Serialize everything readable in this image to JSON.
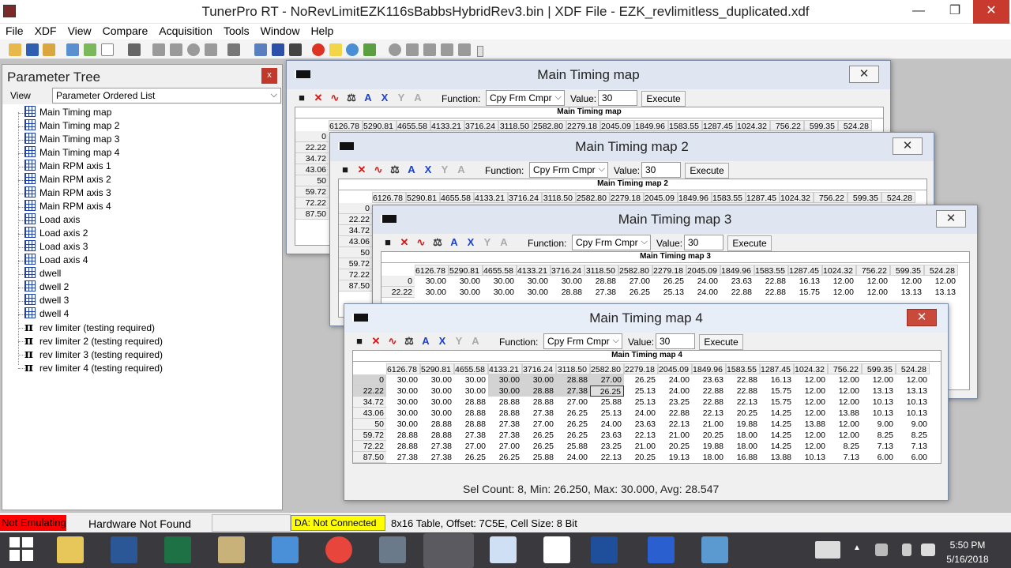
{
  "app": {
    "title": "TunerPro RT - NoRevLimitEZK116sBabbsHybridRev3.bin | XDF File - EZK_revlimitless_duplicated.xdf",
    "minimize": "—",
    "maximize": "❐",
    "close": "✕"
  },
  "menu": [
    "File",
    "XDF",
    "View",
    "Compare",
    "Acquisition",
    "Tools",
    "Window",
    "Help"
  ],
  "tree": {
    "title": "Parameter Tree",
    "close": "x",
    "view_label": "View",
    "view_value": "Parameter Ordered List",
    "items": [
      {
        "label": "Main Timing map",
        "icon": "table-icon"
      },
      {
        "label": "Main Timing map 2",
        "icon": "table-icon"
      },
      {
        "label": "Main Timing map 3",
        "icon": "table-icon"
      },
      {
        "label": "Main Timing map 4",
        "icon": "table-icon"
      },
      {
        "label": "Main RPM axis 1",
        "icon": "table-icon"
      },
      {
        "label": "Main RPM axis 2",
        "icon": "table-icon"
      },
      {
        "label": "Main RPM axis 3",
        "icon": "table-icon"
      },
      {
        "label": "Main RPM axis 4",
        "icon": "table-icon"
      },
      {
        "label": "Load axis",
        "icon": "table-icon"
      },
      {
        "label": "Load axis 2",
        "icon": "table-icon"
      },
      {
        "label": "Load axis 3",
        "icon": "table-icon"
      },
      {
        "label": "Load axis 4",
        "icon": "table-icon"
      },
      {
        "label": "dwell",
        "icon": "table-icon"
      },
      {
        "label": "dwell 2",
        "icon": "table-icon"
      },
      {
        "label": "dwell 3",
        "icon": "table-icon"
      },
      {
        "label": "dwell 4",
        "icon": "table-icon"
      },
      {
        "label": "rev limiter (testing required)",
        "icon": "pi-icon"
      },
      {
        "label": "rev limiter 2 (testing required)",
        "icon": "pi-icon"
      },
      {
        "label": "rev limiter 3 (testing required)",
        "icon": "pi-icon"
      },
      {
        "label": "rev limiter 4 (testing required)",
        "icon": "pi-icon"
      }
    ]
  },
  "editor": {
    "function_label": "Function:",
    "function_value": "Cpy Frm Cmpr",
    "value_label": "Value:",
    "value_value": "30",
    "execute": "Execute"
  },
  "columns": [
    "6126.78",
    "5290.81",
    "4655.58",
    "4133.21",
    "3716.24",
    "3118.50",
    "2582.80",
    "2279.18",
    "2045.09",
    "1849.96",
    "1583.55",
    "1287.45",
    "1024.32",
    "756.22",
    "599.35",
    "524.28"
  ],
  "rows": [
    "0",
    "22.22",
    "34.72",
    "43.06",
    "50",
    "59.72",
    "72.22",
    "87.50"
  ],
  "windows": {
    "w1": {
      "title": "Main Timing map",
      "grid_title": "Main Timing map"
    },
    "w2": {
      "title": "Main Timing map 2",
      "grid_title": "Main Timing map 2"
    },
    "w3": {
      "title": "Main Timing map 3",
      "grid_title": "Main Timing map 3"
    },
    "w4": {
      "title": "Main Timing map 4",
      "grid_title": "Main Timing map 4"
    }
  },
  "map3_values": [
    [
      "30.00",
      "30.00",
      "30.00",
      "30.00",
      "30.00",
      "28.88",
      "27.00",
      "26.25",
      "24.00",
      "23.63",
      "22.88",
      "16.13",
      "12.00",
      "12.00",
      "12.00",
      "12.00"
    ],
    [
      "30.00",
      "30.00",
      "30.00",
      "30.00",
      "28.88",
      "27.38",
      "26.25",
      "25.13",
      "24.00",
      "22.88",
      "22.88",
      "15.75",
      "12.00",
      "12.00",
      "13.13",
      "13.13"
    ]
  ],
  "map4_values": [
    [
      "30.00",
      "30.00",
      "30.00",
      "30.00",
      "30.00",
      "28.88",
      "27.00",
      "26.25",
      "24.00",
      "23.63",
      "22.88",
      "16.13",
      "12.00",
      "12.00",
      "12.00",
      "12.00"
    ],
    [
      "30.00",
      "30.00",
      "30.00",
      "30.00",
      "28.88",
      "27.38",
      "26.25",
      "25.13",
      "24.00",
      "22.88",
      "22.88",
      "15.75",
      "12.00",
      "12.00",
      "13.13",
      "13.13"
    ],
    [
      "30.00",
      "30.00",
      "28.88",
      "28.88",
      "28.88",
      "27.00",
      "25.88",
      "25.13",
      "23.25",
      "22.88",
      "22.13",
      "15.75",
      "12.00",
      "12.00",
      "10.13",
      "10.13"
    ],
    [
      "30.00",
      "30.00",
      "28.88",
      "28.88",
      "27.38",
      "26.25",
      "25.13",
      "24.00",
      "22.88",
      "22.13",
      "20.25",
      "14.25",
      "12.00",
      "13.88",
      "10.13",
      "10.13"
    ],
    [
      "30.00",
      "28.88",
      "28.88",
      "27.38",
      "27.00",
      "26.25",
      "24.00",
      "23.63",
      "22.13",
      "21.00",
      "19.88",
      "14.25",
      "13.88",
      "12.00",
      "9.00",
      "9.00"
    ],
    [
      "28.88",
      "28.88",
      "27.38",
      "27.38",
      "26.25",
      "26.25",
      "23.63",
      "22.13",
      "21.00",
      "20.25",
      "18.00",
      "14.25",
      "12.00",
      "12.00",
      "8.25",
      "8.25"
    ],
    [
      "28.88",
      "27.38",
      "27.00",
      "27.00",
      "26.25",
      "25.88",
      "23.25",
      "21.00",
      "20.25",
      "19.88",
      "18.00",
      "14.25",
      "12.00",
      "8.25",
      "7.13",
      "7.13"
    ],
    [
      "27.38",
      "27.38",
      "26.25",
      "26.25",
      "25.88",
      "24.00",
      "22.13",
      "20.25",
      "19.13",
      "18.00",
      "16.88",
      "13.88",
      "10.13",
      "7.13",
      "6.00",
      "6.00"
    ]
  ],
  "partial_values_right": [
    "00",
    "13",
    "00",
    "13",
    "00",
    "00"
  ],
  "selection_status": "Sel Count: 8, Min: 26.250, Max: 30.000, Avg: 28.547",
  "status": {
    "emulating": "Not Emulating",
    "hardware": "Hardware Not Found",
    "da": "DA: Not Connected",
    "table_info": "8x16 Table, Offset: 7C5E,  Cell Size: 8 Bit"
  },
  "clock": {
    "time": "5:50 PM",
    "date": "5/16/2018"
  }
}
